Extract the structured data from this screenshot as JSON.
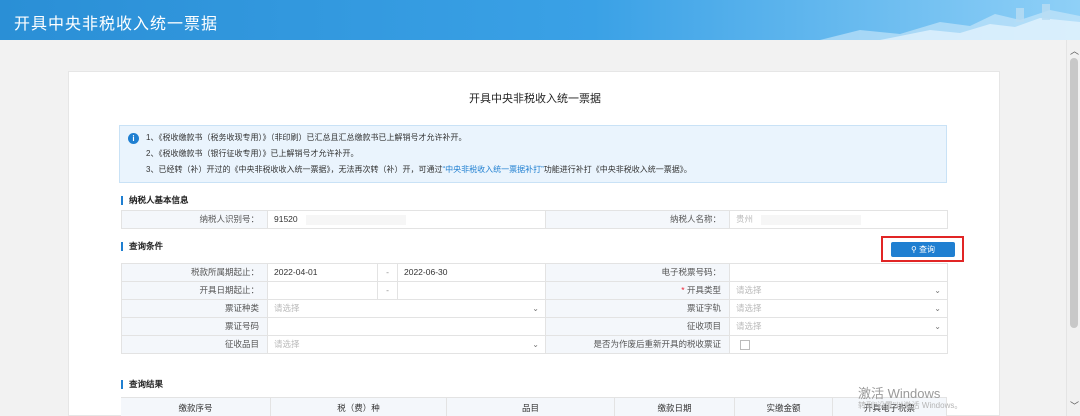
{
  "header": {
    "title": "开具中央非税收入统一票据"
  },
  "page": {
    "title": "开具中央非税收入统一票据"
  },
  "notice": {
    "line1": "1、《税收缴款书（税务收现专用）》（非印刷）已汇总且汇总缴款书已上解销号才允许补开。",
    "line2": "2、《税收缴款书（银行征收专用）》已上解销号才允许补开。",
    "line3_prefix": "3、已经转（补）开过的《中央非税收收入统一票据》，无法再次转（补）开，可通过",
    "line3_link": "“中央非税收入统一票据补打”",
    "line3_suffix": "功能进行补打《中央非税收入统一票据》。"
  },
  "taxpayer": {
    "section_title": "纳税人基本信息",
    "id_label": "纳税人识别号：",
    "id_value": "91520",
    "name_label": "纳税人名称：",
    "name_value": "贵州"
  },
  "query": {
    "section_title": "查询条件",
    "button_label": "查询",
    "tax_period_label": "税款所属期起止：",
    "tax_period_start": "2022-04-01",
    "tax_period_end": "2022-06-30",
    "dash": "-",
    "e_ticket_label": "电子税票号码：",
    "issue_date_label": "开具日期起止：",
    "issue_type_required": "*",
    "issue_type_label": "开具类型",
    "ticket_kind_label": "票证种类",
    "ticket_word_label": "票证字轨",
    "ticket_no_label": "票证号码",
    "levy_item_label": "征收项目",
    "levy_sub_label": "征收品目",
    "reissue_label": "是否为作废后重新开具的税收票证",
    "placeholder": "请选择"
  },
  "results": {
    "section_title": "查询结果",
    "columns": [
      "缴款序号",
      "税（费）种",
      "品目",
      "缴款日期",
      "实缴金额",
      "开具电子税票"
    ]
  },
  "watermark": {
    "line1": "激活 Windows",
    "line2": "转到\"设置\"以激活 Windows。"
  }
}
